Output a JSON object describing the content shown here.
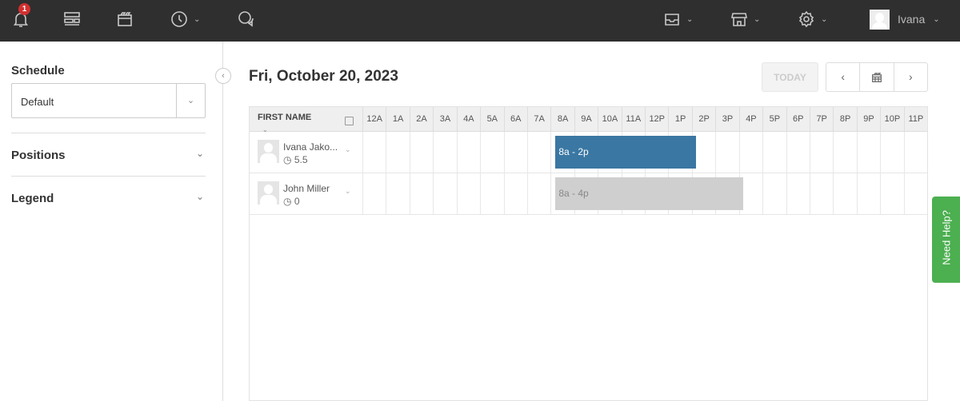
{
  "topbar": {
    "notification_count": "1",
    "user_name": "Ivana",
    "icons": [
      "bell-icon",
      "layout-icon",
      "calendar-icon",
      "clock-icon",
      "chat-icon",
      "inbox-icon",
      "store-icon",
      "gear-icon"
    ]
  },
  "sidebar": {
    "schedule_label": "Schedule",
    "schedule_value": "Default",
    "positions_label": "Positions",
    "legend_label": "Legend"
  },
  "main": {
    "date": "Fri, October 20, 2023",
    "today_label": "TODAY",
    "grid": {
      "first_name_header": "FIRST NAME",
      "hours": [
        "12A",
        "1A",
        "2A",
        "3A",
        "4A",
        "5A",
        "6A",
        "7A",
        "8A",
        "9A",
        "10A",
        "11A",
        "12P",
        "1P",
        "2P",
        "3P",
        "4P",
        "5P",
        "6P",
        "7P",
        "8P",
        "9P",
        "10P",
        "11P"
      ],
      "rows": [
        {
          "name": "Ivana Jako...",
          "hours": "5.5",
          "shift": {
            "label": "8a - 2p",
            "start": 8,
            "end": 14,
            "color": "#3a77a3",
            "text_color": "#ffffff"
          }
        },
        {
          "name": "John Miller",
          "hours": "0",
          "shift": {
            "label": "8a - 4p",
            "start": 8,
            "end": 16,
            "color": "#cfcfcf",
            "text_color": "#888888"
          }
        }
      ]
    }
  },
  "help_label": "Need Help?"
}
